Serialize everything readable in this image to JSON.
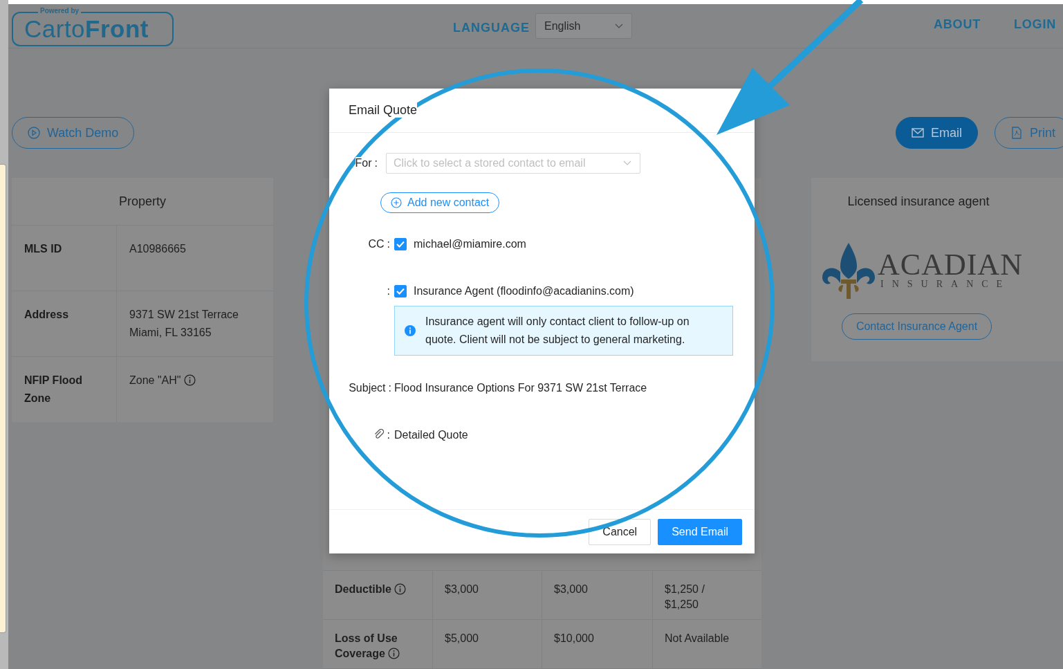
{
  "header": {
    "logo_tagline": "Powered by",
    "logo_light": "Carto",
    "logo_bold": "Front",
    "language_label": "LANGUAGE",
    "language_value": "English",
    "nav": [
      "ABOUT",
      "LOGIN"
    ]
  },
  "actions": {
    "watch_demo": "Watch Demo",
    "email": "Email",
    "print": "Print"
  },
  "property_table": {
    "title": "Property",
    "rows": [
      {
        "label": "MLS ID",
        "lines": [
          "A10986665"
        ],
        "info": false
      },
      {
        "label": "Address",
        "lines": [
          "9371 SW 21st Terrace",
          "Miami, FL 33165"
        ],
        "info": false
      },
      {
        "label": "NFIP Flood Zone",
        "lines": [
          "Zone \"AH\""
        ],
        "info": true
      }
    ]
  },
  "coverage_table": {
    "rows": [
      {
        "label": "Deductible",
        "info": true,
        "cells": [
          "$3,000",
          "$3,000",
          "$1,250 / $1,250"
        ]
      },
      {
        "label": "Loss of Use Coverage",
        "info": true,
        "cells": [
          "$5,000",
          "$10,000",
          "Not Available"
        ]
      }
    ]
  },
  "agent": {
    "title": "Licensed insurance agent",
    "logo_name": "ACADIAN",
    "logo_sub": "INSURANCE",
    "button": "Contact Insurance Agent"
  },
  "modal": {
    "title": "Email Quote",
    "colon": ":",
    "for_label": "For",
    "for_placeholder": "Click to select a stored contact to email",
    "add_contact": "Add new contact",
    "recipients": [
      {
        "label": "CC",
        "text": "michael@miamire.com",
        "checked": true
      },
      {
        "text": "Insurance Agent (floodinfo@acadianins.com)",
        "checked": true
      }
    ],
    "notice": "Insurance agent will only contact client to follow-up on quote. Client will not be subject to general marketing.",
    "subject_label": "Subject",
    "subject": "Flood Insurance Options For 9371 SW 21st Terrace",
    "attachment": "Detailed Quote",
    "cancel": "Cancel",
    "send": "Send Email"
  }
}
